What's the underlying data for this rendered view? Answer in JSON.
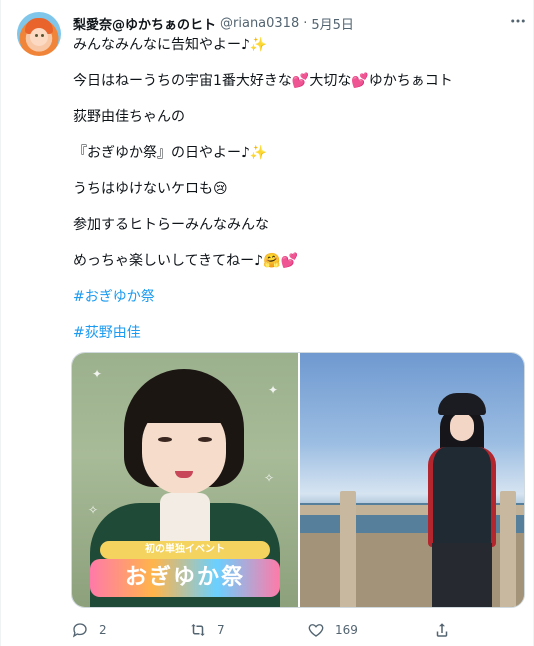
{
  "tweet": {
    "display_name": "梨愛奈@ゆかちぁのヒト",
    "handle": "@riana0318",
    "separator": "·",
    "date": "5月5日",
    "more_icon": "more-icon",
    "lines": [
      "みんなみんなに告知やよー♪✨",
      "今日はねーうちの宇宙1番大好きな💕大切な💕ゆかちぁコト",
      "荻野由佳ちゃんの",
      "『おぎゆか祭』の日やよー♪✨",
      "うちはゆけないケロも😢",
      "参加するヒトらーみんなみんな",
      "めっちゃ楽しいしてきてねー♪🤗💕"
    ],
    "hashtags": [
      "#おぎゆか祭",
      "#荻野由佳"
    ]
  },
  "media": {
    "image1": {
      "banner_text": "初の単独イベント",
      "logo_text": "おぎゆか祭"
    },
    "image2": {}
  },
  "actions": {
    "reply_count": "2",
    "retweet_count": "7",
    "like_count": "169"
  },
  "colors": {
    "link": "#1d9bf0",
    "secondary_text": "#536471",
    "primary_text": "#0f1419"
  }
}
